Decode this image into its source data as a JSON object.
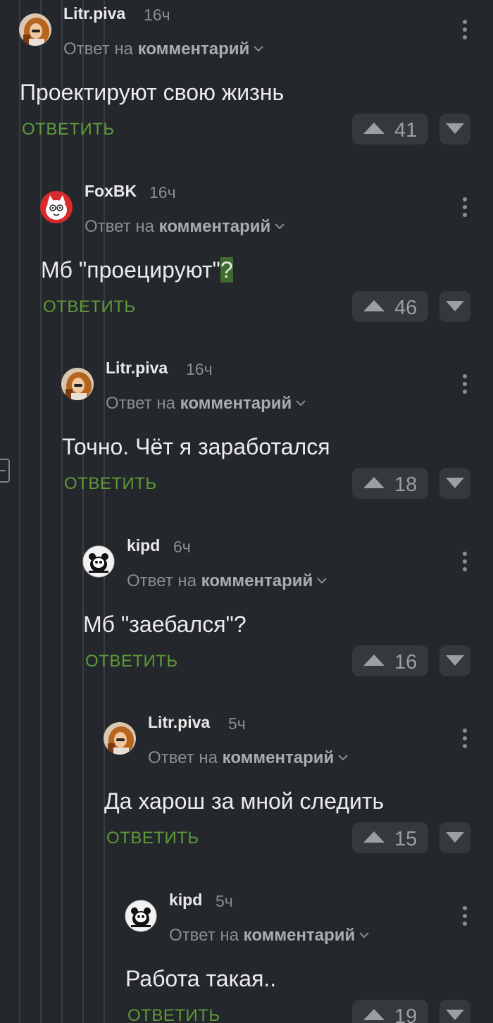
{
  "comments": [
    {
      "username": "Litr.piva",
      "time": "16ч",
      "reply_prefix": "Ответ на",
      "reply_target": "комментарий",
      "text_before": "Проектируют свою жизнь",
      "text_highlight": "",
      "text_after": "",
      "reply_label": "ОТВЕТИТЬ",
      "score": "41",
      "avatar": "girl-photo-avatar"
    },
    {
      "username": "FoxBK",
      "time": "16ч",
      "reply_prefix": "Ответ на",
      "reply_target": "комментарий",
      "text_before": "Мб \"проецируют\"",
      "text_highlight": "?",
      "text_after": "",
      "reply_label": "ОТВЕТИТЬ",
      "score": "46",
      "avatar": "cartoon-cat-avatar"
    },
    {
      "username": "Litr.piva",
      "time": "16ч",
      "reply_prefix": "Ответ на",
      "reply_target": "комментарий",
      "text_before": "Точно. Чёт я заработался",
      "text_highlight": "",
      "text_after": "",
      "reply_label": "ОТВЕТИТЬ",
      "score": "18",
      "avatar": "girl-photo-avatar"
    },
    {
      "username": "kipd",
      "time": "6ч",
      "reply_prefix": "Ответ на",
      "reply_target": "комментарий",
      "text_before": "Мб \"заебался\"?",
      "text_highlight": "",
      "text_after": "",
      "reply_label": "ОТВЕТИТЬ",
      "score": "16",
      "avatar": "panda-avatar"
    },
    {
      "username": "Litr.piva",
      "time": "5ч",
      "reply_prefix": "Ответ на",
      "reply_target": "комментарий",
      "text_before": "Да харош за мной следить",
      "text_highlight": "",
      "text_after": "",
      "reply_label": "ОТВЕТИТЬ",
      "score": "15",
      "avatar": "girl-photo-avatar"
    },
    {
      "username": "kipd",
      "time": "5ч",
      "reply_prefix": "Ответ на",
      "reply_target": "комментарий",
      "text_before": "Работа такая..",
      "text_highlight": "",
      "text_after": "",
      "reply_label": "ОТВЕТИТЬ",
      "score": "19",
      "avatar": "panda-avatar"
    }
  ],
  "colors": {
    "background": "#24272b",
    "reply_green": "#5e9a3a",
    "vote_button": "#35383d",
    "muted_text": "#8a8d91",
    "highlight": "#3f6b2e"
  },
  "icons": {
    "upvote": "triangle-up-icon",
    "downvote": "triangle-down-icon",
    "more": "vertical-dots-icon",
    "chevron": "chevron-down-icon",
    "collapse": "collapse-thread-icon"
  }
}
